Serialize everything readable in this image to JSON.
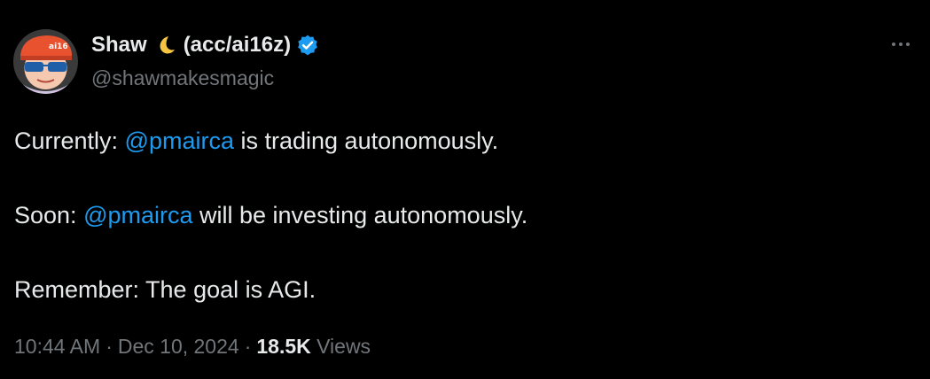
{
  "colors": {
    "background": "#000000",
    "text_primary": "#e7e9ea",
    "text_secondary": "#71767b",
    "link": "#1d9bf0",
    "verified": "#1d9bf0"
  },
  "author": {
    "display_name": "Shaw",
    "name_emoji": "crescent-moon-icon",
    "name_suffix": "(acc/ai16z)",
    "handle": "@shawmakesmagic",
    "verified": true,
    "avatar_icon": "cartoon-avatar-icon"
  },
  "menu": {
    "icon": "more-horizontal-icon"
  },
  "tweet": {
    "paragraphs": [
      {
        "before": "Currently: ",
        "mention": "@pmairca",
        "after": " is trading autonomously."
      },
      {
        "before": "Soon: ",
        "mention": "@pmairca",
        "after": " will be investing autonomously."
      },
      {
        "before": "Remember: The goal is AGI.",
        "mention": "",
        "after": ""
      }
    ]
  },
  "meta": {
    "time": "10:44 AM",
    "date": "Dec 10, 2024",
    "separator": "·",
    "views_count": "18.5K",
    "views_label": "Views"
  }
}
